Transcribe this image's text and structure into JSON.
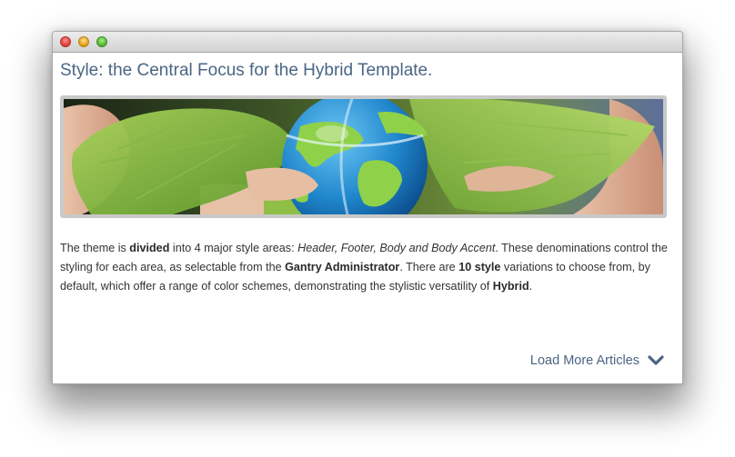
{
  "window": {
    "controls": [
      "close",
      "minimize",
      "zoom"
    ]
  },
  "article": {
    "title": "Style: the Central Focus for the Hybrid Template.",
    "image": {
      "icon": "globe-in-leaves-image"
    },
    "paragraph": {
      "t1": "The theme is ",
      "b1": "divided",
      "t2": " into 4 major style areas: ",
      "i1": "Header, Footer, Body and Body Accent",
      "t3": ". These denominations control the styling for each area, as selectable from the ",
      "b2": "Gantry Administrator",
      "t4": ". There are ",
      "b3": "10 style",
      "t5": " variations to choose from, by default, which offer a range of color schemes, demonstrating the stylistic versatility of ",
      "b4": "Hybrid",
      "t6": "."
    }
  },
  "load_more": {
    "label": "Load More Articles",
    "icon": "chevron-down-icon"
  },
  "colors": {
    "heading": "#4a6584",
    "text": "#333333",
    "image_border": "#c9c9c9"
  }
}
